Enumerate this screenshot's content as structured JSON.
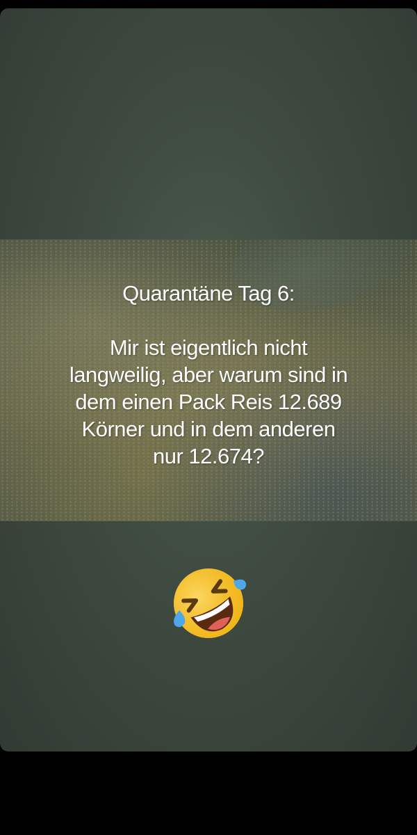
{
  "post": {
    "title": "Quarantäne Tag 6:",
    "body_lines": [
      "Mir ist eigentlich nicht",
      "langweilig, aber warum sind in",
      "dem einen Pack Reis 12.689",
      "Körner und in dem anderen",
      "nur 12.674?"
    ],
    "emoji": "rolling-on-the-floor-laughing-icon"
  },
  "colors": {
    "background": "#3e4a40",
    "outer": "#000000",
    "text": "#ffffff",
    "emoji_face": "#f6c12b"
  }
}
